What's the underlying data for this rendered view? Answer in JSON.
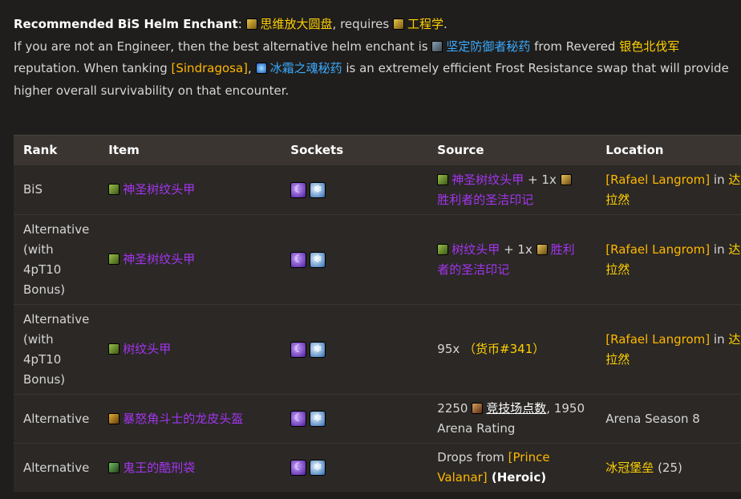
{
  "intro": {
    "line1_label": "Recommended BiS Helm Enchant",
    "line1_colon": ": ",
    "enchant_name": "思维放大圆盘",
    "requires_text": ", requires ",
    "profession": "工程学",
    "period": ".",
    "line2_text": "If you are not an Engineer, then the best alternative helm enchant is ",
    "alt_enchant": "坚定防御者秘药",
    "from_text": " from Revered ",
    "faction": "银色北伐军",
    "line3_text": "reputation. When tanking ",
    "boss": "[Sindragosa]",
    "comma": ", ",
    "frost_item": "冰霜之魂秘药",
    "line3_rest": " is an extremely efficient Frost Resistance swap that will provide",
    "line4_text": "higher overall survivability on that encounter."
  },
  "table": {
    "headers": [
      "Rank",
      "Item",
      "Sockets",
      "Source",
      "Location"
    ],
    "rows": [
      {
        "rank": "BiS",
        "item": "神圣树纹头甲",
        "source_item": "神圣树纹头甲",
        "source_plus": " + 1x ",
        "source_mark": "胜利者的圣洁印记",
        "vendor": "[Rafael Langrom]",
        "in_text": " in ",
        "zone": "达拉然"
      },
      {
        "rank": "Alternative (with 4pT10 Bonus)",
        "item": "神圣树纹头甲",
        "source_item": "树纹头甲",
        "source_plus": " + 1x ",
        "source_mark": "胜利者的圣洁印记",
        "vendor": "[Rafael Langrom]",
        "in_text": " in ",
        "zone": "达拉然"
      },
      {
        "rank": "Alternative (with 4pT10 Bonus)",
        "item": "树纹头甲",
        "source_amount": "95x",
        "source_currency": "（货币#341）",
        "vendor": "[Rafael Langrom]",
        "in_text": " in ",
        "zone": "达拉然"
      },
      {
        "rank": "Alternative",
        "item": "暴怒角斗士的龙皮头盔",
        "source_points": "2250",
        "source_points_label": "竞技场点数",
        "source_rating": ", 1950 Arena Rating",
        "location": "Arena Season 8"
      },
      {
        "rank": "Alternative",
        "item": "鬼王的酷刑袋",
        "source_drops": "Drops from ",
        "source_boss": "[Prince Valanar]",
        "source_mode": " (Heroic)",
        "location_zone": "冰冠堡垒",
        "location_size": " (25)"
      }
    ]
  },
  "sockets": {
    "purple_icon": "meta-gem-icon",
    "blue_icon": "frost-gem-icon"
  }
}
